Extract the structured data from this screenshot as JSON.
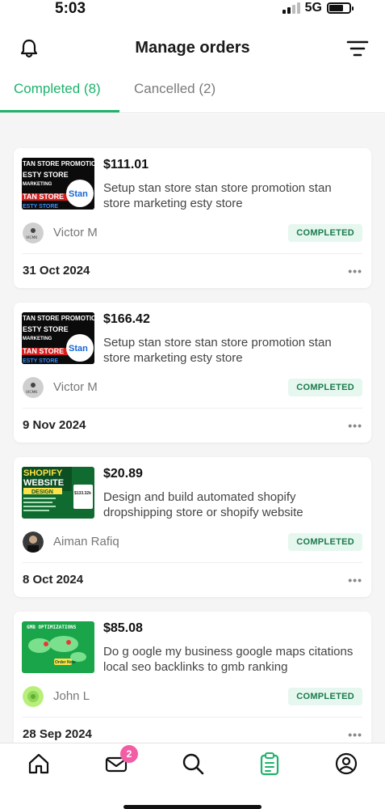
{
  "status": {
    "time": "5:03",
    "network": "5G"
  },
  "header": {
    "title": "Manage orders",
    "bell_icon": "bell-icon",
    "filter_icon": "filter-icon"
  },
  "tabs": [
    {
      "label": "Completed (8)",
      "active": true
    },
    {
      "label": "Cancelled (2)",
      "active": false
    }
  ],
  "colors": {
    "accent": "#1db36b",
    "badge_bg": "#e6f7ef",
    "badge_text": "#1a7a4c",
    "notif_badge": "#f15ea5"
  },
  "orders": [
    {
      "price": "$111.01",
      "description": "Setup stan store stan store promotion stan store marketing esty store",
      "seller": "Victor M",
      "status": "COMPLETED",
      "date": "31 Oct 2024",
      "thumb_lines": [
        "TAN STORE PROMOTION",
        "ESTY STORE",
        "MARKETING",
        "TAN STORE",
        "ESTY STORE"
      ],
      "thumb_logo": "Stan",
      "avatar_text": "VICMK"
    },
    {
      "price": "$166.42",
      "description": "Setup stan store stan store promotion stan store marketing esty store",
      "seller": "Victor M",
      "status": "COMPLETED",
      "date": "9 Nov 2024",
      "thumb_lines": [
        "TAN STORE PROMOTIO",
        "ESTY STORE",
        "MARKETING",
        "TAN STORE",
        "ESTY STORE"
      ],
      "thumb_logo": "Stan",
      "avatar_text": "VICMK"
    },
    {
      "price": "$20.89",
      "description": "Design and build automated shopify dropshipping store or shopify website",
      "seller": "Aiman Rafiq",
      "status": "COMPLETED",
      "date": "8 Oct 2024",
      "thumb_lines": [
        "SHOPIFY",
        "WEBSITE",
        "DESIGN",
        "$133.32k"
      ],
      "thumb_logo": "",
      "avatar_text": ""
    },
    {
      "price": "$85.08",
      "description": "Do g oogle my business google maps citations local seo backlinks to gmb ranking",
      "seller": "John L",
      "status": "COMPLETED",
      "date": "28 Sep 2024",
      "thumb_lines": [
        "GMB OPTIMIZATIONS",
        "Order Now"
      ],
      "thumb_logo": "",
      "avatar_text": ""
    }
  ],
  "bottom_nav": [
    {
      "icon": "home-icon"
    },
    {
      "icon": "inbox-icon",
      "badge": "2"
    },
    {
      "icon": "search-icon"
    },
    {
      "icon": "orders-icon",
      "active": true
    },
    {
      "icon": "profile-icon"
    }
  ]
}
